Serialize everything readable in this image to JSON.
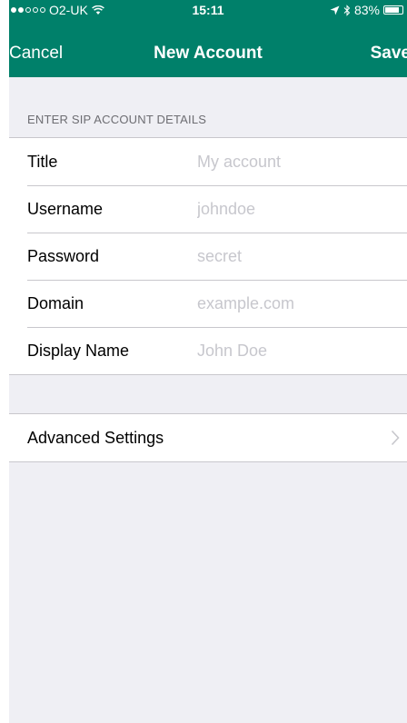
{
  "status_bar": {
    "carrier": "O2-UK",
    "time": "15:11",
    "battery": "83%",
    "battery_level": 0.83
  },
  "nav": {
    "cancel_label": "Cancel",
    "title": "New Account",
    "save_label": "Save"
  },
  "section_header": "ENTER SIP ACCOUNT DETAILS",
  "fields": [
    {
      "label": "Title",
      "placeholder": "My account"
    },
    {
      "label": "Username",
      "placeholder": "johndoe"
    },
    {
      "label": "Password",
      "placeholder": "secret"
    },
    {
      "label": "Domain",
      "placeholder": "example.com"
    },
    {
      "label": "Display Name",
      "placeholder": "John Doe"
    }
  ],
  "advanced": {
    "label": "Advanced Settings"
  },
  "colors": {
    "accent": "#00806a",
    "background": "#efeff4",
    "placeholder": "#c7c7cd"
  },
  "icons": [
    "signal-dots-icon",
    "wifi-icon",
    "location-arrow-icon",
    "bluetooth-icon",
    "battery-icon",
    "chevron-right-icon"
  ]
}
